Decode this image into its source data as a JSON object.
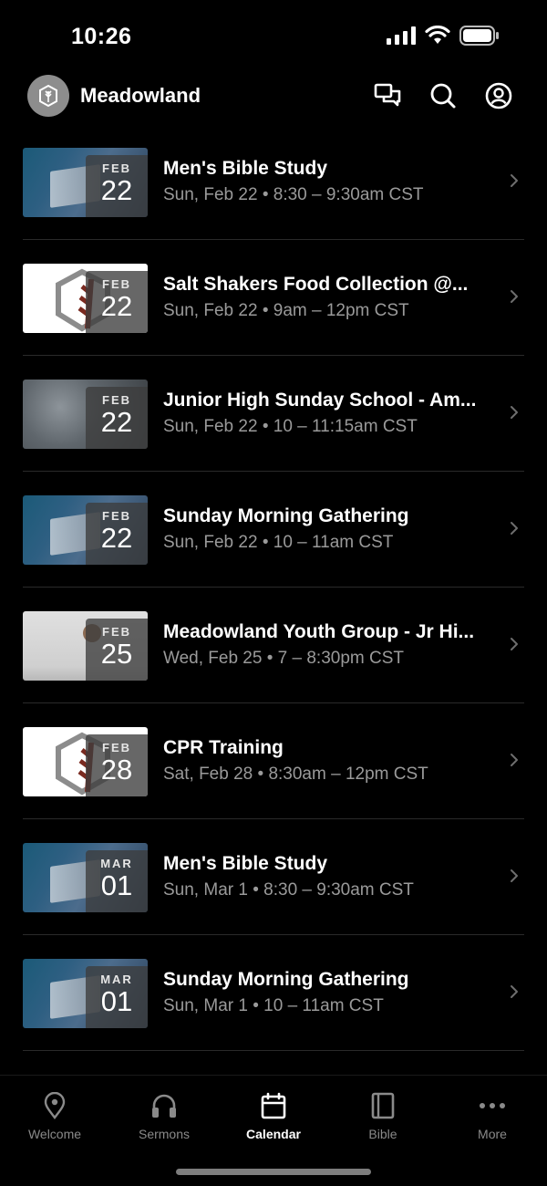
{
  "status_bar": {
    "time": "10:26"
  },
  "header": {
    "org_name": "Meadowland",
    "icons": [
      "chat-icon",
      "search-icon",
      "profile-icon"
    ]
  },
  "events": [
    {
      "title": "Men's Bible Study",
      "date": "Sun, Feb 22",
      "time": "8:30 – 9:30am CST",
      "month": "FEB",
      "day": "22",
      "image": "bible"
    },
    {
      "title": "Salt Shakers Food Collection @...",
      "date": "Sun, Feb 22",
      "time": "9am – 12pm CST",
      "month": "FEB",
      "day": "22",
      "image": "logo"
    },
    {
      "title": "Junior High Sunday School - Am...",
      "date": "Sun, Feb 22",
      "time": "10 – 11:15am CST",
      "month": "FEB",
      "day": "22",
      "image": "stone"
    },
    {
      "title": "Sunday Morning Gathering",
      "date": "Sun, Feb 22",
      "time": "10 – 11am CST",
      "month": "FEB",
      "day": "22",
      "image": "bible"
    },
    {
      "title": "Meadowland Youth Group - Jr Hi...",
      "date": "Wed, Feb 25",
      "time": "7 – 8:30pm CST",
      "month": "FEB",
      "day": "25",
      "image": "wall"
    },
    {
      "title": "CPR Training",
      "date": "Sat, Feb 28",
      "time": "8:30am – 12pm CST",
      "month": "FEB",
      "day": "28",
      "image": "logo"
    },
    {
      "title": "Men's Bible Study",
      "date": "Sun, Mar 1",
      "time": "8:30 – 9:30am CST",
      "month": "MAR",
      "day": "01",
      "image": "bible"
    },
    {
      "title": "Sunday Morning Gathering",
      "date": "Sun, Mar 1",
      "time": "10 – 11am CST",
      "month": "MAR",
      "day": "01",
      "image": "bible"
    }
  ],
  "separator": "•",
  "tabs": [
    {
      "label": "Welcome",
      "icon": "location-pin-icon",
      "active": false
    },
    {
      "label": "Sermons",
      "icon": "headphones-icon",
      "active": false
    },
    {
      "label": "Calendar",
      "icon": "calendar-icon",
      "active": true
    },
    {
      "label": "Bible",
      "icon": "book-icon",
      "active": false
    },
    {
      "label": "More",
      "icon": "more-dots-icon",
      "active": false
    }
  ],
  "colors": {
    "background": "#000000",
    "meta_text": "#9a9a9a",
    "inactive_tab": "#8a8a8a",
    "active_tab": "#ffffff"
  }
}
